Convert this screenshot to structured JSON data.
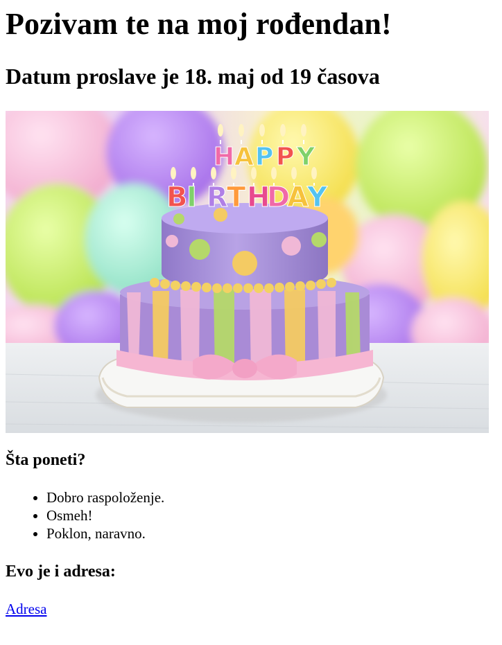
{
  "page": {
    "title": "Pozivam te na moj rođendan!",
    "subtitle": "Datum proslave je 18. maj od 19 časova",
    "hero_image": {
      "alt": "",
      "candle_letters_top": [
        "H",
        "A",
        "P",
        "P",
        "Y"
      ],
      "candle_letters_bottom": [
        "B",
        "I",
        "R",
        "T",
        "H",
        "D",
        "A",
        "Y"
      ]
    },
    "bring_heading": "Šta poneti?",
    "bring_items": [
      "Dobro raspoloženje.",
      "Osmeh!",
      "Poklon, naravno."
    ],
    "address_heading": "Evo je i adresa:",
    "address_link": "Adresa"
  },
  "colors": {
    "link": "#0000ee",
    "text": "#000000",
    "background": "#ffffff"
  }
}
